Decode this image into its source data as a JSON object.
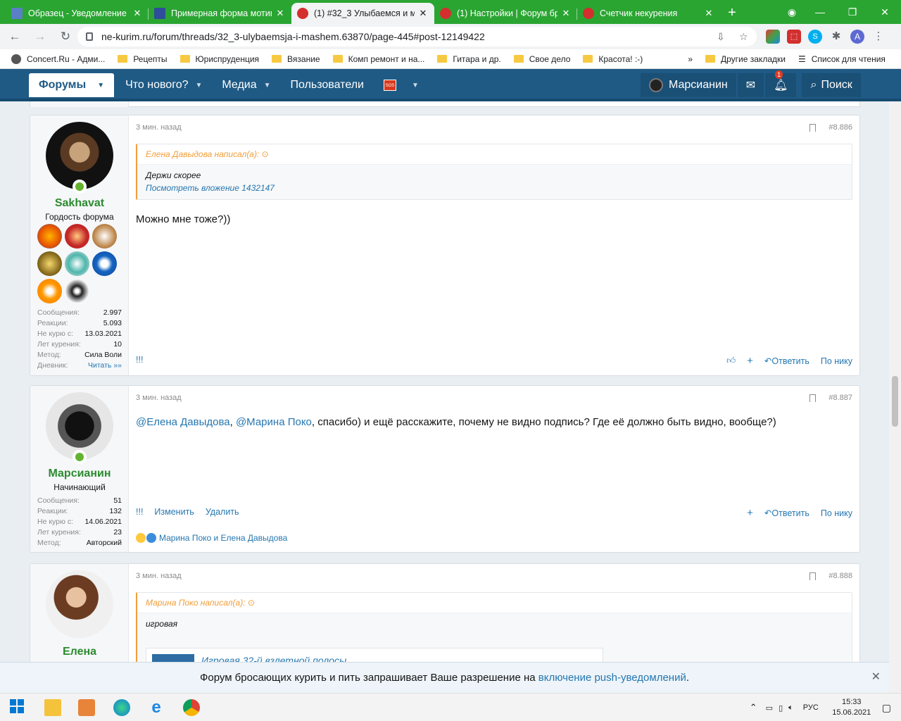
{
  "browser": {
    "tabs": [
      {
        "label": "Образец - Уведомление",
        "color": "#5b7fc7",
        "active": false
      },
      {
        "label": "Примерная форма мотив",
        "color": "#2e4d9a",
        "active": false
      },
      {
        "label": "(1) #32_3 Улыбаемся и ма",
        "color": "#d32f2f",
        "active": true
      },
      {
        "label": "(1) Настройки | Форум бр",
        "color": "#d32f2f",
        "active": false
      },
      {
        "label": "Счетчик некурения",
        "color": "#d32f2f",
        "active": false
      }
    ],
    "url": "ne-kurim.ru/forum/threads/32_3-ulybaemsja-i-mashem.63870/page-445#post-12149422",
    "profile_letter": "A",
    "bookmarks": [
      {
        "label": "Concert.Ru - Адми...",
        "type": "site"
      },
      {
        "label": "Рецепты",
        "type": "folder"
      },
      {
        "label": "Юриспруденция",
        "type": "folder"
      },
      {
        "label": "Вязание",
        "type": "folder"
      },
      {
        "label": "Комп ремонт и на...",
        "type": "folder"
      },
      {
        "label": "Гитара и др.",
        "type": "folder"
      },
      {
        "label": "Свое дело",
        "type": "folder"
      },
      {
        "label": "Красота! :-)",
        "type": "folder"
      }
    ],
    "bookmarks_more": "»",
    "other_bookmarks": "Другие закладки",
    "reading_list": "Список для чтения"
  },
  "forum_nav": {
    "items": [
      "Форумы",
      "Что нового?",
      "Медиа",
      "Пользователи"
    ],
    "sos_label": "SOS",
    "user_name": "Марсианин",
    "notif_count": "1",
    "search_label": "Поиск"
  },
  "posts": [
    {
      "author": "Sakhavat",
      "title": "Гордость форума",
      "time": "3 мин. назад",
      "number": "#8.886",
      "quote_author": "Елена Давыдова написал(а):",
      "quote_text": "Держи скорее",
      "quote_link": "Посмотреть вложение 1432147",
      "message": "Можно мне тоже?))",
      "stats": [
        {
          "k": "Сообщения:",
          "v": "2.997"
        },
        {
          "k": "Реакции:",
          "v": "5.093"
        },
        {
          "k": "Не курю с:",
          "v": "13.03.2021"
        },
        {
          "k": "Лет курения:",
          "v": "10"
        },
        {
          "k": "Метод:",
          "v": "Сила Воли"
        },
        {
          "k": "Дневник:",
          "v": "Читать »»"
        }
      ],
      "action_left": [
        "!!!"
      ],
      "action_right": [
        "+",
        "Ответить",
        "По нику"
      ]
    },
    {
      "author": "Марсианин",
      "title": "Начинающий",
      "time": "3 мин. назад",
      "number": "#8.887",
      "mention1": "@Елена Давыдова",
      "sep1": ", ",
      "mention2": "@Марина Поко",
      "message": ", спасибо) и ещё расскажите, почему не видно подпись? Где её должно быть видно, вообще?)",
      "stats": [
        {
          "k": "Сообщения:",
          "v": "51"
        },
        {
          "k": "Реакции:",
          "v": "132"
        },
        {
          "k": "Не курю с:",
          "v": "14.06.2021"
        },
        {
          "k": "Лет курения:",
          "v": "23"
        },
        {
          "k": "Метод:",
          "v": "Авторский"
        }
      ],
      "action_left": [
        "!!!",
        "Изменить",
        "Удалить"
      ],
      "action_right": [
        "+",
        "Ответить",
        "По нику"
      ],
      "reactions": "Марина Поко и Елена Давыдова"
    },
    {
      "author": "Елена",
      "time": "3 мин. назад",
      "number": "#8.888",
      "quote_author": "Марина Поко написал(а):",
      "quote_text": "игровая",
      "embed_title": "Игровая 32-й взлетной полосы"
    }
  ],
  "push_bar": {
    "text": "Форум бросающих курить и пить запрашивает Ваше разрешение на ",
    "link": "включение push-уведомлений",
    "end": "."
  },
  "taskbar": {
    "lang": "РУС",
    "time": "15:33",
    "date": "15.06.2021"
  },
  "colors": {
    "tab_green": "#2aa532",
    "nav_blue": "#1f5a85",
    "username_green": "#2c8a2f",
    "link_blue": "#2577b1",
    "quote_orange": "#f29e3a"
  }
}
